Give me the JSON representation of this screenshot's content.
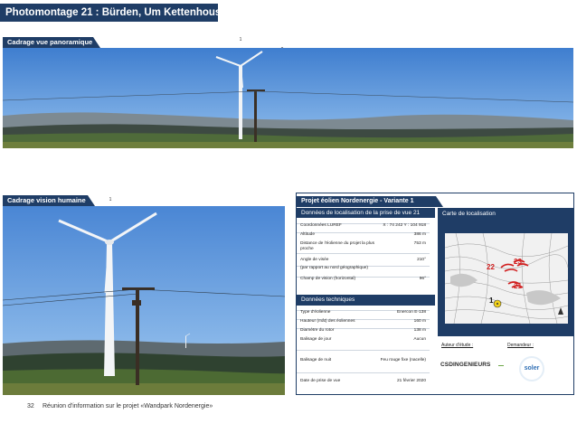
{
  "page": {
    "title": "Photomontage 21 : Bürden, Um Kettenhouscht",
    "footer_number": "32",
    "footer_text": "Réunion d'information sur le projet «Wandpark Nordenergie»"
  },
  "panorama": {
    "label": "Cadrage vue panoramique",
    "markers": [
      "1",
      "2"
    ]
  },
  "human": {
    "label": "Cadrage vision humaine",
    "markers": [
      "1",
      "2"
    ]
  },
  "info_panel": {
    "project_title": "Projet éolien Nordenergie - Variante 1",
    "localisation_header": "Données de localisation de la prise de vue 21",
    "map_header": "Carte de localisation",
    "localisation_rows": [
      {
        "key": "Coordonnées LUREF",
        "value": "X : 74 242    Y : 104 918"
      },
      {
        "key": "Altitude",
        "value": "386 m"
      },
      {
        "key": "Distance de l'éolienne du projet la plus proche",
        "value": "753 m"
      },
      {
        "key": "Angle de visée",
        "value": "210°"
      },
      {
        "key": "(par rapport au nord géographique)",
        "value": ""
      },
      {
        "key": "Champ de vision (horizontal)",
        "value": "96°"
      }
    ],
    "tech_header": "Données techniques",
    "tech_rows": [
      {
        "key": "Type d'éolienne",
        "value": "Enercon E-138"
      },
      {
        "key": "Hauteur (mât) des éoliennes",
        "value": "160 m"
      },
      {
        "key": "Diamètre du rotor",
        "value": "138 m"
      },
      {
        "key": "Balisage de jour",
        "value": "Aucun"
      },
      {
        "key": "Balisage de nuit",
        "value": "Feu rouge fixe (nacelle)"
      },
      {
        "key": "Date de prise de vue",
        "value": "21 février 2020"
      }
    ],
    "map_labels": [
      "22",
      "23",
      "21",
      "1"
    ],
    "author_label": "Auteur d'étude :",
    "client_label": "Demandeur :",
    "author_logo": "CSDINGENIEURS",
    "client_logo": "soler"
  },
  "colors": {
    "navy": "#1f3d66",
    "sky": "#4d86cf",
    "map_red": "#d11f1f"
  }
}
